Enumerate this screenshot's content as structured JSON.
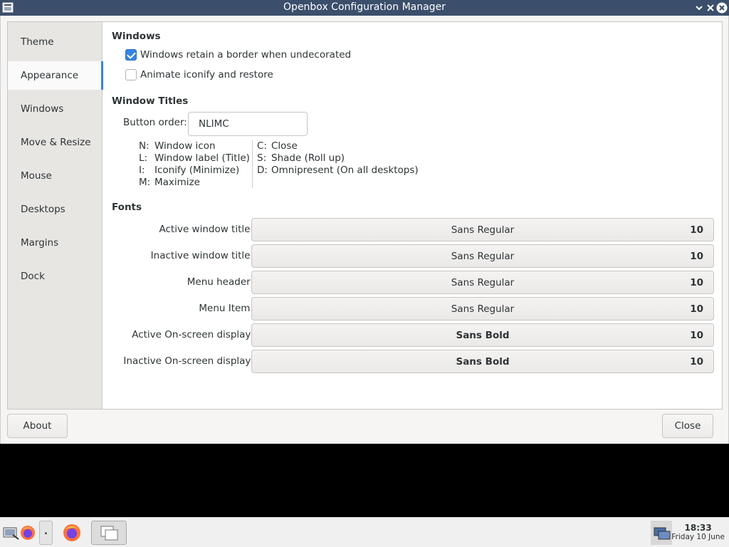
{
  "window": {
    "title": "Openbox Configuration Manager"
  },
  "sidebar": {
    "items": [
      {
        "label": "Theme"
      },
      {
        "label": "Appearance"
      },
      {
        "label": "Windows"
      },
      {
        "label": "Move & Resize"
      },
      {
        "label": "Mouse"
      },
      {
        "label": "Desktops"
      },
      {
        "label": "Margins"
      },
      {
        "label": "Dock"
      }
    ],
    "active": "Appearance"
  },
  "windows_section": {
    "heading": "Windows",
    "options": [
      {
        "label": "Windows retain a border when undecorated",
        "checked": true
      },
      {
        "label": "Animate iconify and restore",
        "checked": false
      }
    ]
  },
  "titles_section": {
    "heading": "Window Titles",
    "button_order_label": "Button order:",
    "button_order_value": "NLIMC",
    "legend_left": [
      {
        "key": "N:",
        "desc": "Window icon"
      },
      {
        "key": "L:",
        "desc": "Window label (Title)"
      },
      {
        "key": "I:",
        "desc": "Iconify (Minimize)"
      },
      {
        "key": "M:",
        "desc": "Maximize"
      }
    ],
    "legend_right": [
      {
        "key": "C:",
        "desc": "Close"
      },
      {
        "key": "S:",
        "desc": "Shade (Roll up)"
      },
      {
        "key": "D:",
        "desc": "Omnipresent (On all desktops)"
      }
    ]
  },
  "fonts_section": {
    "heading": "Fonts",
    "rows": [
      {
        "label": "Active window title:",
        "font": "Sans Regular",
        "size": "10",
        "bold": false
      },
      {
        "label": "Inactive window title:",
        "font": "Sans Regular",
        "size": "10",
        "bold": false
      },
      {
        "label": "Menu header:",
        "font": "Sans Regular",
        "size": "10",
        "bold": false
      },
      {
        "label": "Menu Item:",
        "font": "Sans Regular",
        "size": "10",
        "bold": false
      },
      {
        "label": "Active On-screen display:",
        "font": "Sans Bold",
        "size": "10",
        "bold": true
      },
      {
        "label": "Inactive On-screen display:",
        "font": "Sans Bold",
        "size": "10",
        "bold": true
      }
    ]
  },
  "dialog_buttons": {
    "about": "About",
    "close": "Close"
  },
  "taskbar": {
    "launcher_separator": ".",
    "clock_time": "18:33",
    "clock_date": "Friday 10 June"
  },
  "colors": {
    "titlebar": "#3b4e6b",
    "accent": "#3584e4"
  }
}
